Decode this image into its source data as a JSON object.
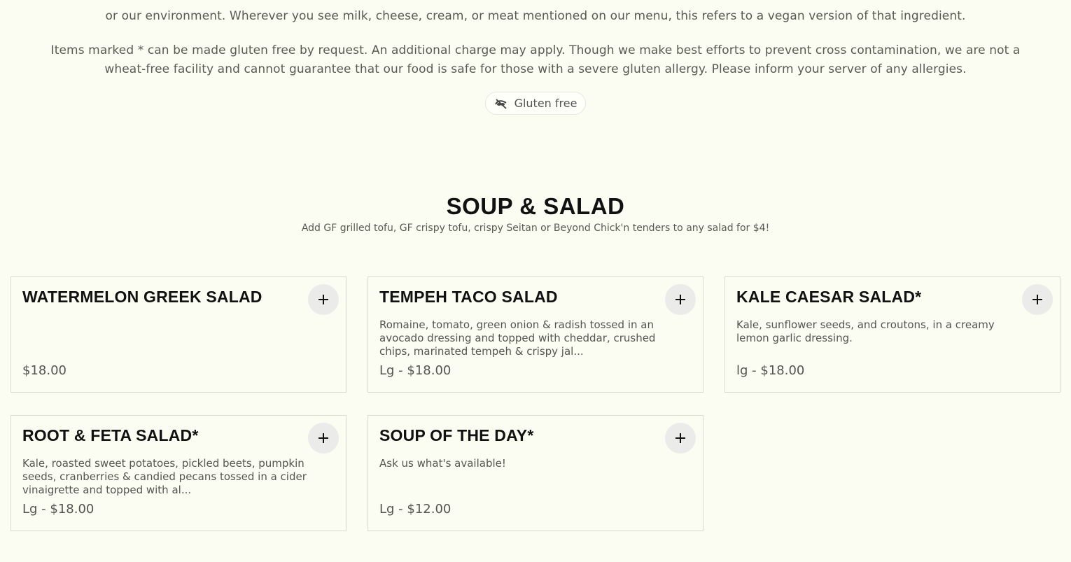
{
  "intro": {
    "line_top": "or our environment. Wherever you see milk, cheese, cream, or meat mentioned on our menu, this refers to a vegan version of that ingredient.",
    "gf_line1": "Items marked * can be made gluten free by request. An additional charge may apply. Though we make best efforts to prevent cross contamination, we are not a",
    "gf_line2": "wheat-free facility and cannot guarantee that our food is safe for those with a severe gluten allergy. Please inform your server of any allergies."
  },
  "filter_pill": {
    "label": "Gluten free",
    "icon": "gluten-free-icon"
  },
  "section": {
    "title": "SOUP & SALAD",
    "subtitle": "Add GF grilled tofu, GF crispy tofu, crispy Seitan or Beyond Chick'n tenders to any salad for $4!"
  },
  "items": [
    {
      "name": "WATERMELON GREEK SALAD",
      "description": "",
      "price": "$18.00"
    },
    {
      "name": "TEMPEH TACO SALAD",
      "description": "Romaine, tomato, green onion & radish tossed in an avocado dressing and topped with cheddar, crushed chips, marinated tempeh & crispy jal...",
      "price": "Lg - $18.00"
    },
    {
      "name": "KALE CAESAR SALAD*",
      "description": "Kale, sunflower seeds, and croutons, in a creamy lemon garlic dressing.",
      "price": "lg - $18.00"
    },
    {
      "name": "ROOT & FETA SALAD*",
      "description": "Kale, roasted sweet potatoes, pickled beets, pumpkin seeds, cranberries & candied pecans tossed in a cider vinaigrette and topped with al...",
      "price": "Lg - $18.00"
    },
    {
      "name": "SOUP OF THE DAY*",
      "description": "Ask us what's available!",
      "price": "Lg - $12.00"
    }
  ],
  "colors": {
    "background": "#fbfdf2",
    "text": "#111111",
    "muted": "#555550",
    "border": "#d9dbd0"
  }
}
